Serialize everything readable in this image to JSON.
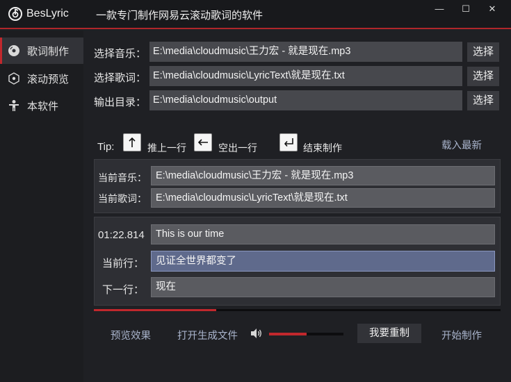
{
  "app": {
    "name": "BesLyric",
    "subtitle": "一款专门制作网易云滚动歌词的软件"
  },
  "window_controls": {
    "minimize": "—",
    "maximize": "☐",
    "close": "✕"
  },
  "sidebar": {
    "items": [
      {
        "label": "歌词制作",
        "icon": "disc-icon",
        "active": true
      },
      {
        "label": "滚动预览",
        "icon": "scroll-preview-icon",
        "active": false
      },
      {
        "label": "本软件",
        "icon": "person-icon",
        "active": false
      }
    ]
  },
  "file_select": {
    "music_label": "选择音乐：",
    "music_value": "E:\\media\\cloudmusic\\王力宏 - 就是现在.mp3",
    "lyric_label": "选择歌词：",
    "lyric_value": "E:\\media\\cloudmusic\\LyricText\\就是现在.txt",
    "output_label": "输出目录：",
    "output_value": "E:\\media\\cloudmusic\\output",
    "choose_label": "选择"
  },
  "tips": {
    "tip": "Tip:",
    "up": "推上一行",
    "space": "空出一行",
    "end": "结束制作",
    "load_latest": "载入最新"
  },
  "current": {
    "music_label": "当前音乐：",
    "music_value": "E:\\media\\cloudmusic\\王力宏 - 就是现在.mp3",
    "lyric_label": "当前歌词：",
    "lyric_value": "E:\\media\\cloudmusic\\LyricText\\就是现在.txt"
  },
  "lyrics": {
    "timestamp": "01:22.814",
    "prev_line": "This is our time",
    "current_label": "当前行：",
    "current_line": "见证全世界都变了",
    "next_label": "下一行：",
    "next_line": "现在"
  },
  "progress": {
    "playback_fraction": 0.3,
    "volume_fraction": 0.5,
    "accent": "#c1282d"
  },
  "bottom": {
    "preview": "预览效果",
    "open_file": "打开生成文件",
    "redo": "我要重制",
    "start": "开始制作"
  }
}
